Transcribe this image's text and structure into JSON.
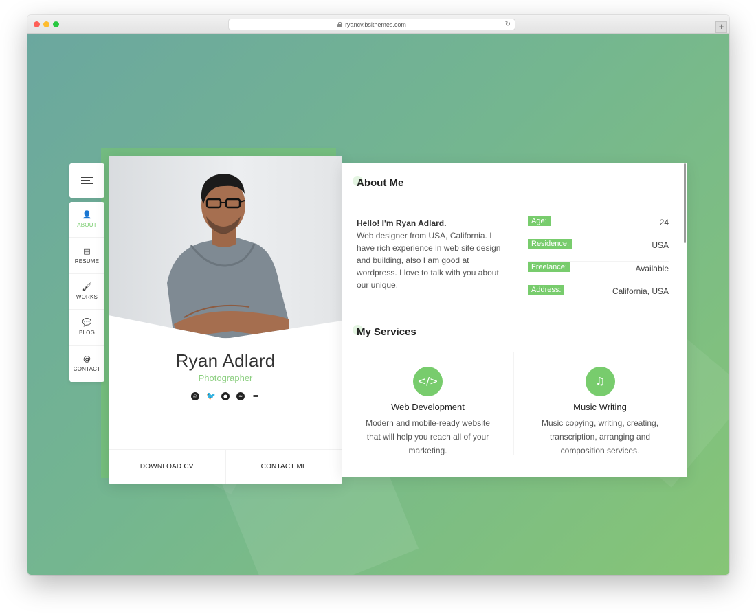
{
  "browser": {
    "url": "ryancv.bslthemes.com",
    "new_tab": "+"
  },
  "menu": [
    {
      "label": "ABOUT",
      "icon": "person-icon",
      "glyph": "👤",
      "active": true
    },
    {
      "label": "RESUME",
      "icon": "document-icon",
      "glyph": "▤"
    },
    {
      "label": "WORKS",
      "icon": "paintbrush-icon",
      "glyph": "🖌"
    },
    {
      "label": "BLOG",
      "icon": "chat-icon",
      "glyph": "💬"
    },
    {
      "label": "CONTACT",
      "icon": "at-icon",
      "glyph": "@"
    }
  ],
  "profile": {
    "name": "Ryan Adlard",
    "role": "Photographer",
    "socials": [
      "dribbble-icon",
      "twitter-icon",
      "github-icon",
      "spotify-icon",
      "stackoverflow-icon"
    ],
    "download_cv": "DOWNLOAD CV",
    "contact_me": "CONTACT ME"
  },
  "about": {
    "title": "About Me",
    "greeting": "Hello! I'm Ryan Adlard.",
    "text": "Web designer from USA, California. I have rich experience in web site design and building, also I am good at wordpress. I love to talk with you about our unique.",
    "info": [
      {
        "key": "Age:",
        "value": "24"
      },
      {
        "key": "Residence:",
        "value": "USA"
      },
      {
        "key": "Freelance:",
        "value": "Available"
      },
      {
        "key": "Address:",
        "value": "California, USA"
      }
    ]
  },
  "services": {
    "title": "My Services",
    "items": [
      {
        "title": "Web Development",
        "icon": "code-icon",
        "glyph": "</>",
        "desc": "Modern and mobile-ready website that will help you reach all of your marketing."
      },
      {
        "title": "Music Writing",
        "icon": "music-note-icon",
        "glyph": "♫",
        "desc": "Music copying, writing, creating, transcription, arranging and composition services."
      }
    ]
  },
  "colors": {
    "accent": "#78cc6d"
  }
}
